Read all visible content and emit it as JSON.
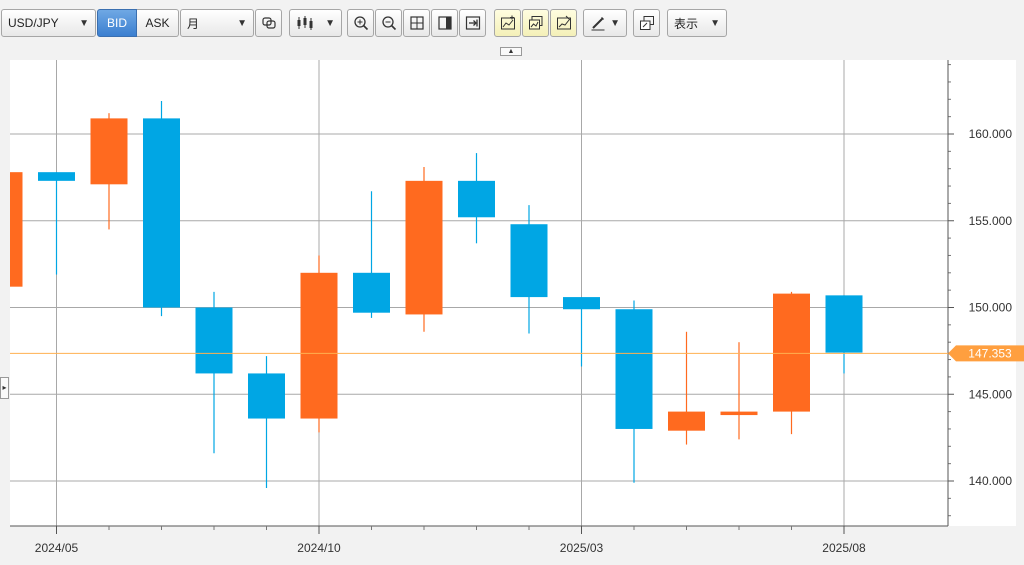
{
  "toolbar": {
    "symbol": "USD/JPY",
    "bid_label": "BID",
    "ask_label": "ASK",
    "timeframe": "月",
    "display_label": "表示",
    "caret": "▼"
  },
  "colors": {
    "up": "#ff6a1f",
    "down": "#00a6e4",
    "price_line": "#ffb050",
    "price_badge": "#ff9f3f",
    "grid": "#a8a8a8",
    "axis_text": "#333333"
  },
  "icons": [
    "link-icon",
    "candlestick-icon",
    "zoom-in-icon",
    "zoom-out-icon",
    "fit-icon",
    "panel-icon",
    "scroll-end-icon",
    "add-indicator-icon",
    "chart-layers-icon",
    "trend-icon",
    "drawing-tool-icon",
    "new-window-icon"
  ],
  "chart_data": {
    "type": "candlestick",
    "ylim": [
      137.5,
      164.5
    ],
    "y_ticks": [
      140,
      145,
      150,
      155,
      160
    ],
    "y_tick_labels": [
      "140.000",
      "145.000",
      "150.000",
      "155.000",
      "160.000"
    ],
    "x_labels": [
      {
        "label": "2024/05",
        "index": 1
      },
      {
        "label": "2024/10",
        "index": 6
      },
      {
        "label": "2025/03",
        "index": 11
      },
      {
        "label": "2025/08",
        "index": 16
      }
    ],
    "current_price": 147.353,
    "current_price_label": "147.353",
    "grid": true,
    "candles": [
      {
        "open": 151.2,
        "high": 157.8,
        "low": 151.2,
        "close": 157.8
      },
      {
        "open": 157.8,
        "high": 157.8,
        "low": 151.9,
        "close": 157.3
      },
      {
        "open": 157.1,
        "high": 161.2,
        "low": 154.5,
        "close": 160.9
      },
      {
        "open": 160.9,
        "high": 161.9,
        "low": 149.5,
        "close": 150.0
      },
      {
        "open": 150.0,
        "high": 150.9,
        "low": 141.6,
        "close": 146.2
      },
      {
        "open": 146.2,
        "high": 147.2,
        "low": 139.6,
        "close": 143.6
      },
      {
        "open": 143.6,
        "high": 153.0,
        "low": 142.8,
        "close": 152.0
      },
      {
        "open": 152.0,
        "high": 156.7,
        "low": 149.4,
        "close": 149.7
      },
      {
        "open": 149.6,
        "high": 158.1,
        "low": 148.6,
        "close": 157.3
      },
      {
        "open": 157.3,
        "high": 158.9,
        "low": 153.7,
        "close": 155.2
      },
      {
        "open": 154.8,
        "high": 155.9,
        "low": 148.5,
        "close": 150.6
      },
      {
        "open": 150.6,
        "high": 150.6,
        "low": 146.6,
        "close": 149.9
      },
      {
        "open": 149.9,
        "high": 150.4,
        "low": 139.9,
        "close": 143.0
      },
      {
        "open": 142.9,
        "high": 148.6,
        "low": 142.1,
        "close": 144.0
      },
      {
        "open": 143.8,
        "high": 148.0,
        "low": 142.4,
        "close": 144.0
      },
      {
        "open": 144.0,
        "high": 150.9,
        "low": 142.7,
        "close": 150.8
      },
      {
        "open": 150.7,
        "high": 150.7,
        "low": 146.2,
        "close": 147.4
      }
    ]
  }
}
